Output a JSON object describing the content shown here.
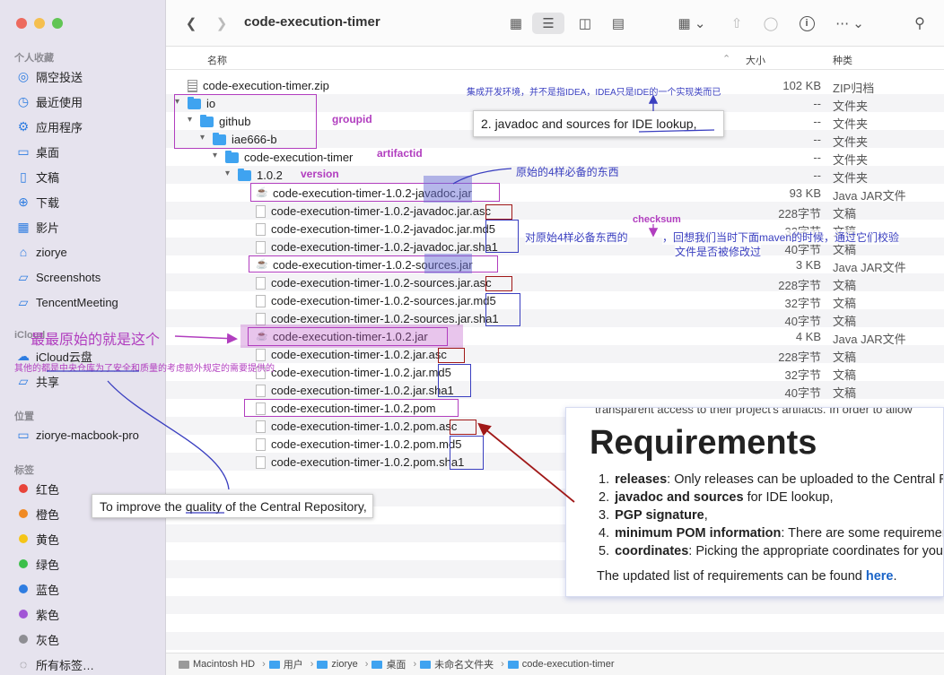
{
  "toolbar": {
    "title": "code-execution-timer"
  },
  "sidebar": {
    "favorites_heading": "个人收藏",
    "favorites": [
      {
        "label": "隔空投送",
        "icon": "airdrop-icon"
      },
      {
        "label": "最近使用",
        "icon": "clock-icon"
      },
      {
        "label": "应用程序",
        "icon": "applications-icon"
      },
      {
        "label": "桌面",
        "icon": "desktop-icon"
      },
      {
        "label": "文稿",
        "icon": "document-icon"
      },
      {
        "label": "下载",
        "icon": "download-icon"
      },
      {
        "label": "影片",
        "icon": "movies-icon"
      },
      {
        "label": "ziorye",
        "icon": "home-icon"
      },
      {
        "label": "Screenshots",
        "icon": "folder-icon"
      },
      {
        "label": "TencentMeeting",
        "icon": "folder-icon"
      }
    ],
    "icloud_heading": "iCloud",
    "icloud": [
      {
        "label": "iCloud云盘",
        "icon": "cloud-icon"
      },
      {
        "label": "共享",
        "icon": "shared-folder-icon"
      }
    ],
    "locations_heading": "位置",
    "locations": [
      {
        "label": "ziorye-macbook-pro",
        "icon": "laptop-icon"
      }
    ],
    "tags_heading": "标签",
    "tags": [
      {
        "label": "红色",
        "color": "#e8443a"
      },
      {
        "label": "橙色",
        "color": "#f08a24"
      },
      {
        "label": "黄色",
        "color": "#f5c518"
      },
      {
        "label": "绿色",
        "color": "#3cbf4a"
      },
      {
        "label": "蓝色",
        "color": "#2f7de1"
      },
      {
        "label": "紫色",
        "color": "#a256d6"
      },
      {
        "label": "灰色",
        "color": "#8e8e93"
      },
      {
        "label": "所有标签…",
        "color": ""
      }
    ]
  },
  "columns": {
    "name": "名称",
    "size": "大小",
    "kind": "种类"
  },
  "files": [
    {
      "name": "code-execution-timer.zip",
      "size": "102 KB",
      "kind": "ZIP归档",
      "type": "zip",
      "indent": 0,
      "chevron": ""
    },
    {
      "name": "io",
      "size": "--",
      "kind": "文件夹",
      "type": "folder",
      "indent": 0,
      "chevron": "v"
    },
    {
      "name": "github",
      "size": "--",
      "kind": "文件夹",
      "type": "folder",
      "indent": 1,
      "chevron": "v"
    },
    {
      "name": "iae666-b",
      "size": "--",
      "kind": "文件夹",
      "type": "folder",
      "indent": 2,
      "chevron": "v"
    },
    {
      "name": "code-execution-timer",
      "size": "--",
      "kind": "文件夹",
      "type": "folder",
      "indent": 3,
      "chevron": "v"
    },
    {
      "name": "1.0.2",
      "size": "--",
      "kind": "文件夹",
      "type": "folder",
      "indent": 4,
      "chevron": "v"
    },
    {
      "name": "code-execution-timer-1.0.2-javadoc.jar",
      "size": "93 KB",
      "kind": "Java JAR文件",
      "type": "jar",
      "indent": 5,
      "chevron": ""
    },
    {
      "name": "code-execution-timer-1.0.2-javadoc.jar.asc",
      "size": "228字节",
      "kind": "文稿",
      "type": "doc",
      "indent": 5,
      "chevron": ""
    },
    {
      "name": "code-execution-timer-1.0.2-javadoc.jar.md5",
      "size": "32字节",
      "kind": "文稿",
      "type": "doc",
      "indent": 5,
      "chevron": ""
    },
    {
      "name": "code-execution-timer-1.0.2-javadoc.jar.sha1",
      "size": "40字节",
      "kind": "文稿",
      "type": "doc",
      "indent": 5,
      "chevron": ""
    },
    {
      "name": "code-execution-timer-1.0.2-sources.jar",
      "size": "3 KB",
      "kind": "Java JAR文件",
      "type": "jar",
      "indent": 5,
      "chevron": ""
    },
    {
      "name": "code-execution-timer-1.0.2-sources.jar.asc",
      "size": "228字节",
      "kind": "文稿",
      "type": "doc",
      "indent": 5,
      "chevron": ""
    },
    {
      "name": "code-execution-timer-1.0.2-sources.jar.md5",
      "size": "32字节",
      "kind": "文稿",
      "type": "doc",
      "indent": 5,
      "chevron": ""
    },
    {
      "name": "code-execution-timer-1.0.2-sources.jar.sha1",
      "size": "40字节",
      "kind": "文稿",
      "type": "doc",
      "indent": 5,
      "chevron": ""
    },
    {
      "name": "code-execution-timer-1.0.2.jar",
      "size": "4 KB",
      "kind": "Java JAR文件",
      "type": "jar",
      "indent": 5,
      "chevron": ""
    },
    {
      "name": "code-execution-timer-1.0.2.jar.asc",
      "size": "228字节",
      "kind": "文稿",
      "type": "doc",
      "indent": 5,
      "chevron": ""
    },
    {
      "name": "code-execution-timer-1.0.2.jar.md5",
      "size": "32字节",
      "kind": "文稿",
      "type": "doc",
      "indent": 5,
      "chevron": ""
    },
    {
      "name": "code-execution-timer-1.0.2.jar.sha1",
      "size": "40字节",
      "kind": "文稿",
      "type": "doc",
      "indent": 5,
      "chevron": ""
    },
    {
      "name": "code-execution-timer-1.0.2.pom",
      "size": "",
      "kind": "",
      "type": "doc",
      "indent": 5,
      "chevron": ""
    },
    {
      "name": "code-execution-timer-1.0.2.pom.asc",
      "size": "",
      "kind": "",
      "type": "doc",
      "indent": 5,
      "chevron": ""
    },
    {
      "name": "code-execution-timer-1.0.2.pom.md5",
      "size": "",
      "kind": "",
      "type": "doc",
      "indent": 5,
      "chevron": ""
    },
    {
      "name": "code-execution-timer-1.0.2.pom.sha1",
      "size": "",
      "kind": "",
      "type": "doc",
      "indent": 5,
      "chevron": ""
    }
  ],
  "pathbar": [
    "Macintosh HD",
    "用户",
    "ziorye",
    "桌面",
    "未命名文件夹",
    "code-execution-timer"
  ],
  "annotations": {
    "groupid": "groupid",
    "artifactid": "artifactid",
    "version": "version",
    "ide_note": "集成开发环境，并不是指IDEA，IDEA只是IDE的一个实现类而已",
    "callout_javadoc": "2. javadoc and sources for IDE lookup,",
    "original_four": "原始的4样必备的东西",
    "checksum": "checksum",
    "checksum_note_1": "对原始4样必备东西的",
    "checksum_note_2": "，回想我们当时下面maven的时候，通过它们校验",
    "checksum_note_3": "文件是否被修改过",
    "most_original": "最最原始的就是这个",
    "others_note": "其他的都是中央仓库为了安全和质量的考虑额外规定的需要提供的",
    "callout_quality": "To improve the quality of the Central Repository,",
    "colors": {
      "purple": "#b13ebf",
      "blue": "#3a3fc0",
      "red": "#a01818",
      "highlight": "#6b6fd6"
    }
  },
  "requirements": {
    "cut_text": "transparent access to their project's artifacts. In order to allow",
    "title": "Requirements",
    "items": [
      {
        "num": "1.",
        "bold": "releases",
        "rest": ": Only releases can be uploaded to the Central Re"
      },
      {
        "num": "2.",
        "bold": "javadoc and sources",
        "rest": " for IDE lookup,"
      },
      {
        "num": "3.",
        "bold": "PGP signature",
        "rest": ","
      },
      {
        "num": "4.",
        "bold": "minimum POM information",
        "rest": ": There are some requirements"
      },
      {
        "num": "5.",
        "bold": "coordinates",
        "rest": ": Picking the appropriate coordinates for your"
      }
    ],
    "footer_text": "The updated list of requirements can be found ",
    "footer_link": "here",
    "footer_end": "."
  }
}
